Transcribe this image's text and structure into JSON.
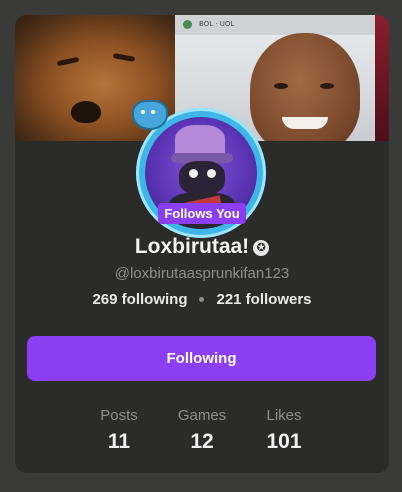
{
  "profile": {
    "follows_badge": "Follows You",
    "display_name": "Loxbirutaa!",
    "verified_glyph": "✪",
    "handle": "@loxbirutaasprunkifan123",
    "following_text": "269 following",
    "followers_text": "221 followers",
    "follow_button_label": "Following"
  },
  "banner": {
    "tv_topbar_text": "BOL · UOL"
  },
  "counts": [
    {
      "label": "Posts",
      "value": "11"
    },
    {
      "label": "Games",
      "value": "12"
    },
    {
      "label": "Likes",
      "value": "101"
    }
  ],
  "colors": {
    "accent": "#8c3ff2",
    "card_bg": "#2b2b29",
    "page_bg": "#3a3a38",
    "avatar_ring": "#3fb6e8"
  },
  "icons": {
    "verified": "verified-badge-icon",
    "separator": "dot-separator-icon"
  }
}
